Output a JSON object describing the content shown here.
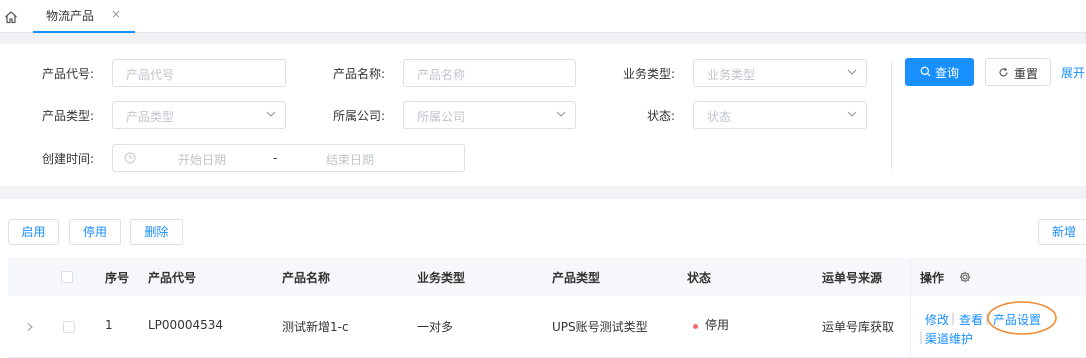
{
  "tab": {
    "label": "物流产品",
    "close": "×"
  },
  "filters": {
    "product_code": {
      "label": "产品代号:",
      "placeholder": "产品代号"
    },
    "product_name": {
      "label": "产品名称:",
      "placeholder": "产品名称"
    },
    "business_type": {
      "label": "业务类型:",
      "placeholder": "业务类型"
    },
    "product_type": {
      "label": "产品类型:",
      "placeholder": "产品类型"
    },
    "company": {
      "label": "所属公司:",
      "placeholder": "所属公司"
    },
    "status": {
      "label": "状态:",
      "placeholder": "状态"
    },
    "created_time": {
      "label": "创建时间:",
      "start_placeholder": "开始日期",
      "separator": "-",
      "end_placeholder": "结束日期"
    }
  },
  "actions": {
    "query": "查询",
    "reset": "重置",
    "expand": "展开"
  },
  "toolbar": {
    "enable": "启用",
    "disable": "停用",
    "delete": "删除",
    "add": "新增"
  },
  "table": {
    "headers": {
      "seq": "序号",
      "code": "产品代号",
      "name": "产品名称",
      "business": "业务类型",
      "ptype": "产品类型",
      "status": "状态",
      "waybill": "运单号来源",
      "ops": "操作"
    },
    "rows": [
      {
        "seq": "1",
        "code": "LP00004534",
        "name": "测试新增1-c",
        "business": "一对多",
        "ptype": "UPS账号测试类型",
        "status": "停用",
        "waybill": "运单号库获取",
        "ops": {
          "edit": "修改",
          "view": "查看",
          "settings": "产品设置",
          "channel": "渠道维护",
          "sep": "|"
        }
      }
    ]
  },
  "colors": {
    "primary": "#1890ff",
    "status_disabled": "#f56c6c",
    "annotation": "#f08a32"
  }
}
